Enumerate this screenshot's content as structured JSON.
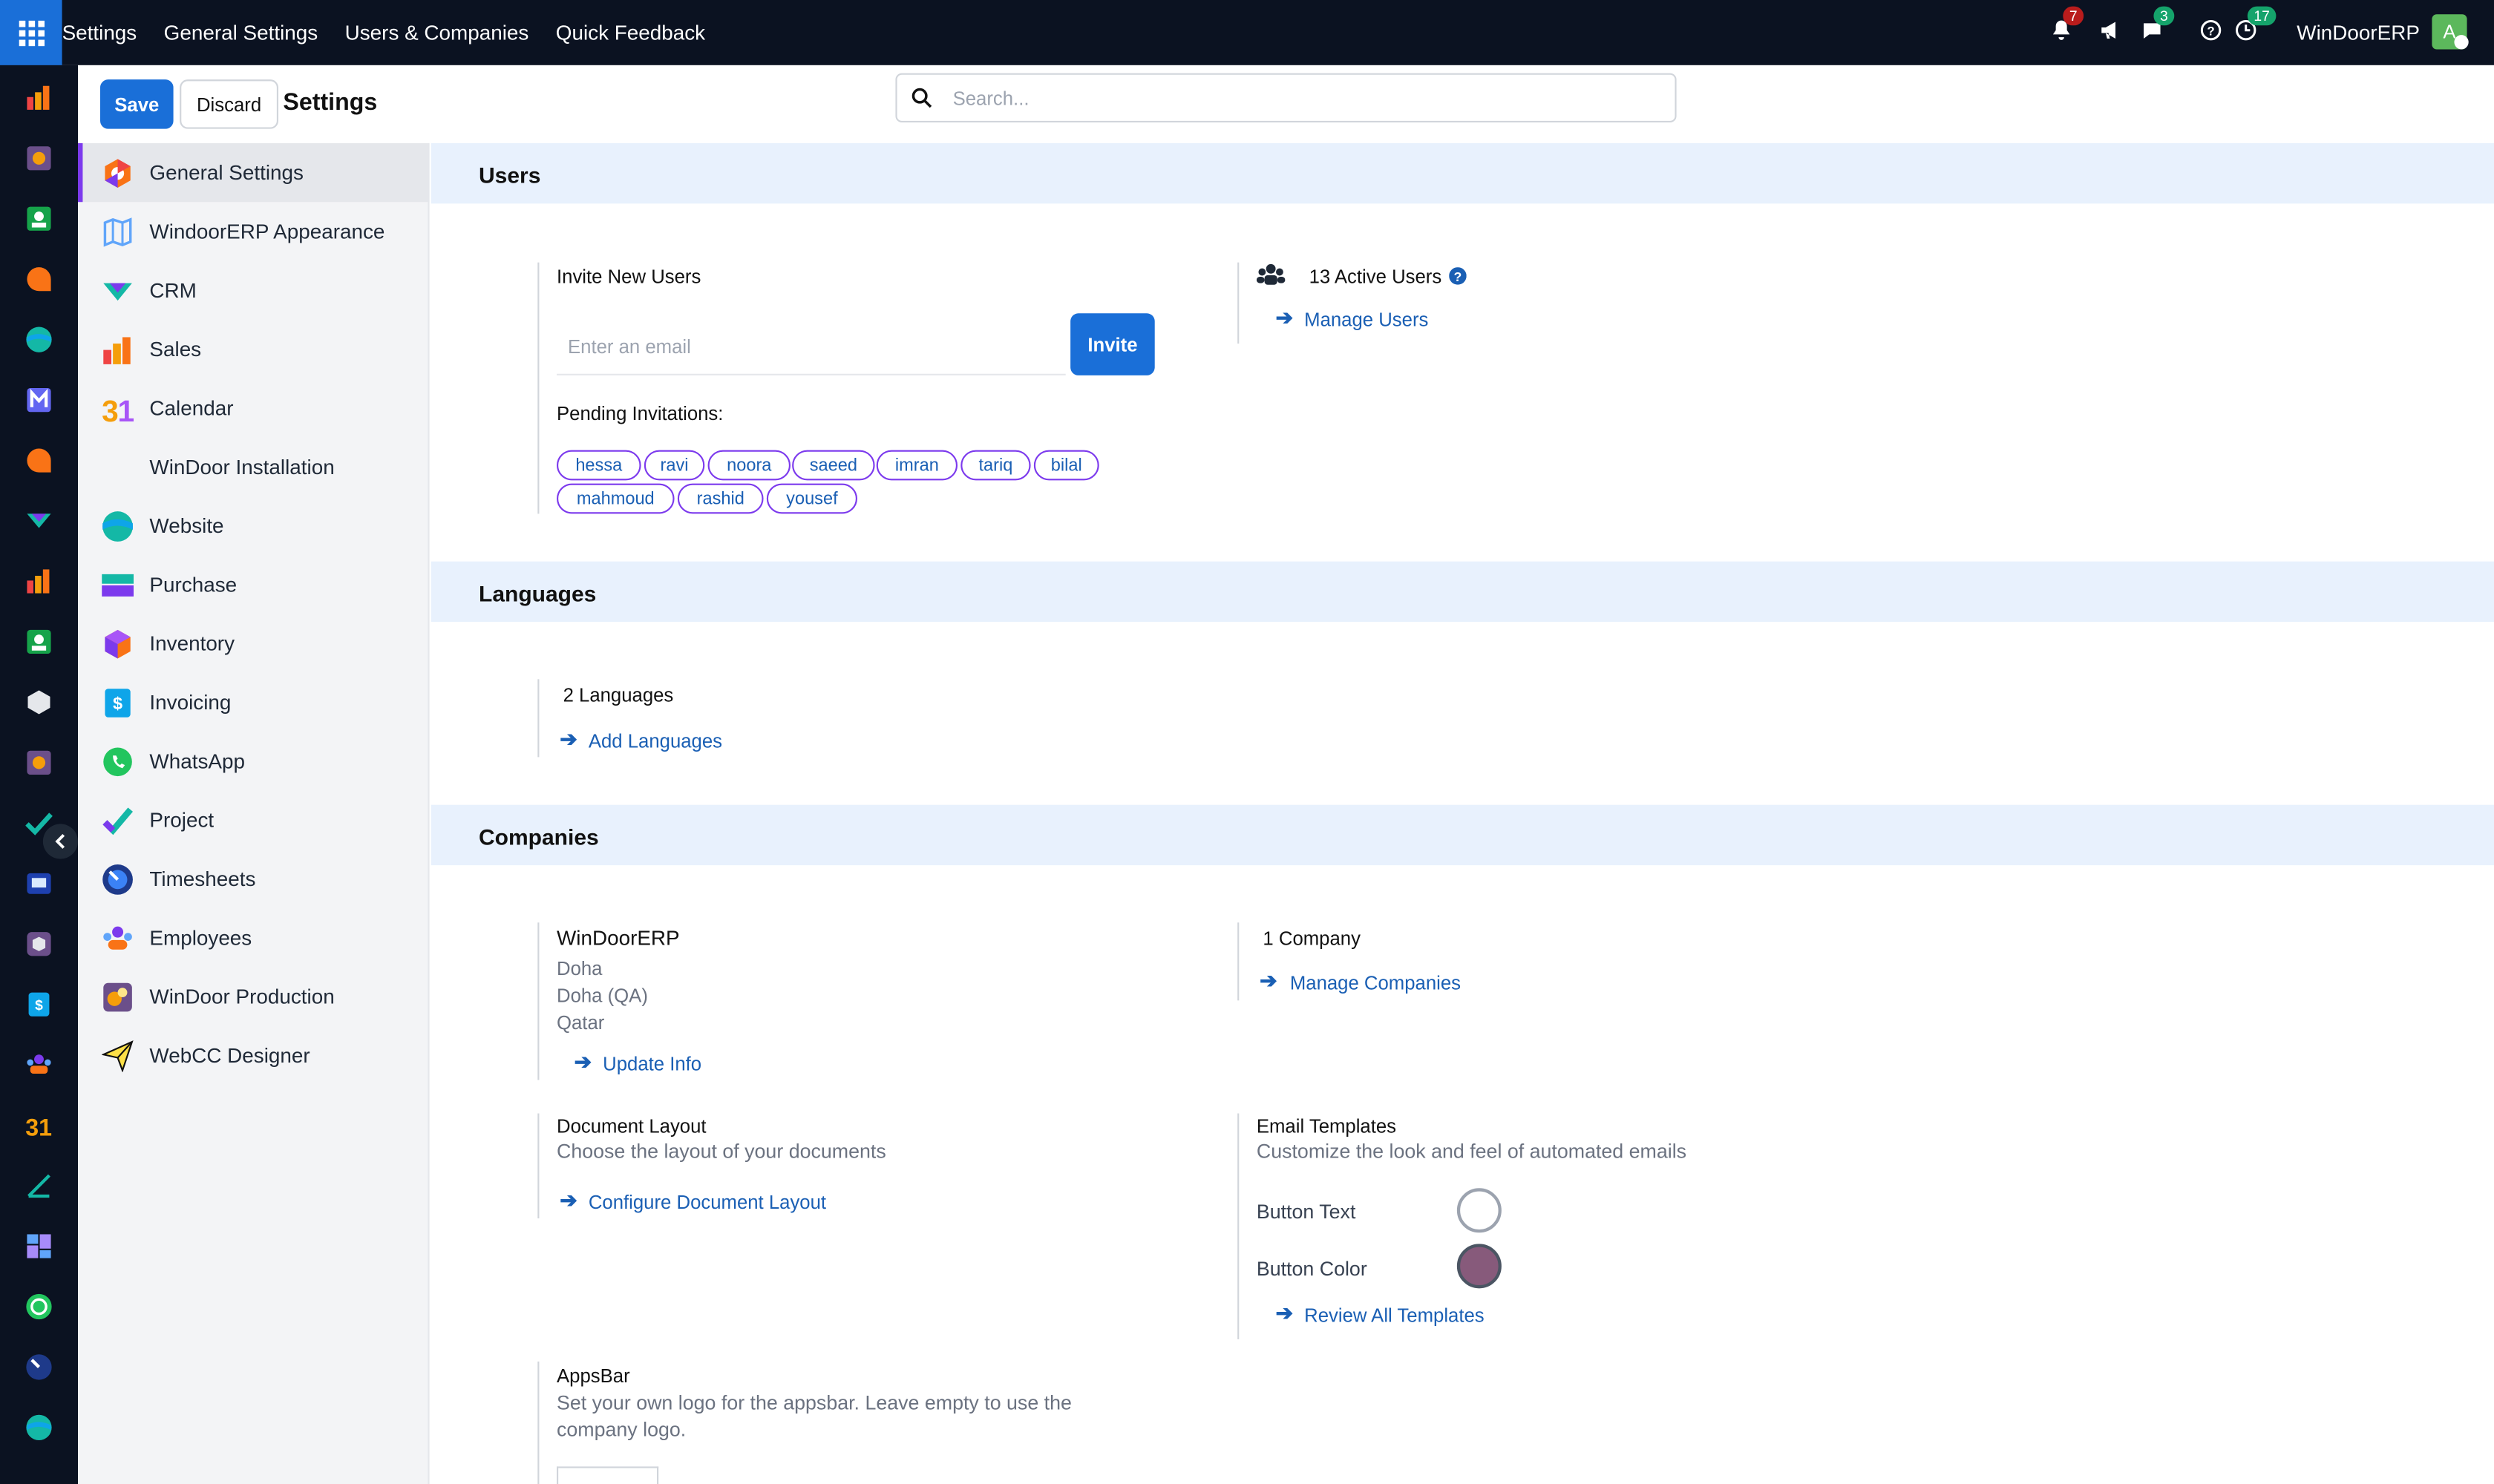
{
  "topbar": {
    "menu": [
      "Settings",
      "General Settings",
      "Users & Companies",
      "Quick Feedback"
    ],
    "notifications_count": "7",
    "messages_count": "3",
    "activities_count": "17",
    "company": "WinDoorERP",
    "avatar_letter": "A"
  },
  "control": {
    "save_label": "Save",
    "discard_label": "Discard",
    "title": "Settings",
    "search_placeholder": "Search..."
  },
  "nav": [
    {
      "label": "General Settings",
      "icon": "general-settings-icon",
      "active": true
    },
    {
      "label": "WindoorERP Appearance",
      "icon": "appearance-icon"
    },
    {
      "label": "CRM",
      "icon": "crm-icon"
    },
    {
      "label": "Sales",
      "icon": "sales-icon"
    },
    {
      "label": "Calendar",
      "icon": "calendar-icon"
    },
    {
      "label": "WinDoor Installation",
      "icon": ""
    },
    {
      "label": "Website",
      "icon": "website-icon"
    },
    {
      "label": "Purchase",
      "icon": "purchase-icon"
    },
    {
      "label": "Inventory",
      "icon": "inventory-icon"
    },
    {
      "label": "Invoicing",
      "icon": "invoicing-icon"
    },
    {
      "label": "WhatsApp",
      "icon": "whatsapp-icon"
    },
    {
      "label": "Project",
      "icon": "project-icon"
    },
    {
      "label": "Timesheets",
      "icon": "timesheets-icon"
    },
    {
      "label": "Employees",
      "icon": "employees-icon"
    },
    {
      "label": "WinDoor Production",
      "icon": "production-icon"
    },
    {
      "label": "WebCC Designer",
      "icon": "designer-icon"
    }
  ],
  "users": {
    "heading": "Users",
    "invite_label": "Invite New Users",
    "email_placeholder": "Enter an email",
    "invite_button": "Invite",
    "pending_label": "Pending Invitations:",
    "pending": [
      "hessa",
      "ravi",
      "noora",
      "saeed",
      "imran",
      "tariq",
      "bilal",
      "mahmoud",
      "rashid",
      "yousef"
    ],
    "active_users": "13 Active Users",
    "manage_users": "Manage Users"
  },
  "languages": {
    "heading": "Languages",
    "count": "2 Languages",
    "add": "Add Languages"
  },
  "companies": {
    "heading": "Companies",
    "name": "WinDoorERP",
    "address": [
      "Doha",
      "Doha (QA)",
      "Qatar"
    ],
    "update": "Update Info",
    "count": "1 Company",
    "manage": "Manage Companies",
    "doc_layout_title": "Document Layout",
    "doc_layout_desc": "Choose the layout of your documents",
    "doc_layout_link": "Configure Document Layout",
    "email_title": "Email Templates",
    "email_desc": "Customize the look and feel of automated emails",
    "button_text_label": "Button Text",
    "button_color_label": "Button Color",
    "button_text_color": "#ffffff",
    "button_color": "#875a7b",
    "review": "Review All Templates",
    "appsbar_title": "AppsBar",
    "appsbar_desc_1": "Set your own logo for the appsbar. Leave empty to use the",
    "appsbar_desc_2": "company logo."
  },
  "colors": {
    "primary": "#1a6fd8",
    "topbar": "#0b1221",
    "link": "#1a5fb4",
    "accent": "#7c3aed"
  }
}
